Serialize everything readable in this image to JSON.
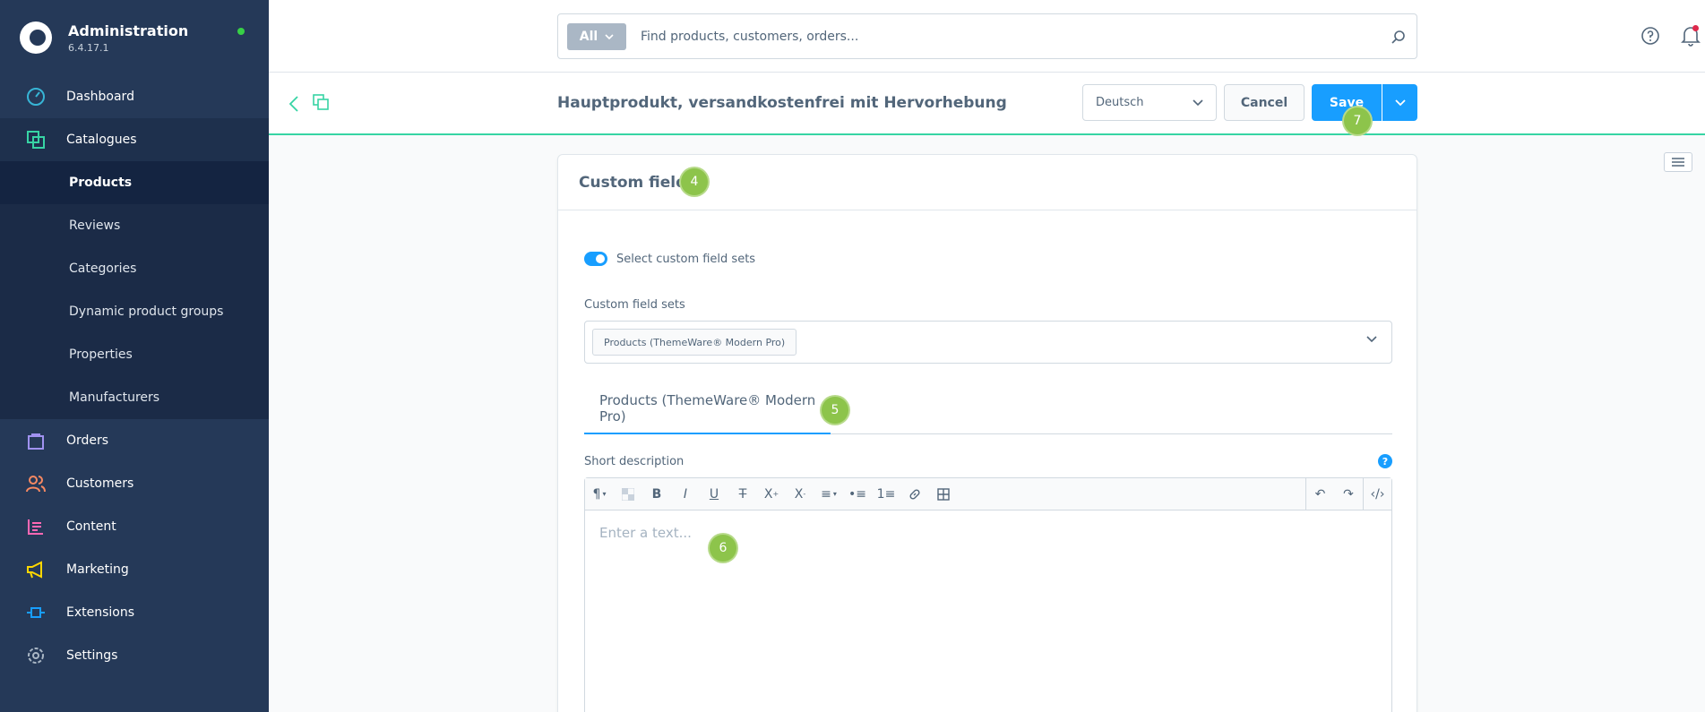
{
  "brand": {
    "title": "Administration",
    "version": "6.4.17.1"
  },
  "nav": {
    "dashboard": "Dashboard",
    "catalogues": "Catalogues",
    "sub": [
      "Products",
      "Reviews",
      "Categories",
      "Dynamic product groups",
      "Properties",
      "Manufacturers"
    ],
    "orders": "Orders",
    "customers": "Customers",
    "content": "Content",
    "marketing": "Marketing",
    "extensions": "Extensions",
    "settings": "Settings"
  },
  "search": {
    "type": "All",
    "placeholder": "Find products, customers, orders..."
  },
  "smartbar": {
    "title": "Hauptprodukt, versandkostenfrei mit Hervorhebung",
    "language": "Deutsch",
    "cancel": "Cancel",
    "save": "Save"
  },
  "card": {
    "title": "Custom fields",
    "toggle_label": "Select custom field sets",
    "sets_label": "Custom field sets",
    "chip": "Products (ThemeWare® Modern Pro)",
    "tab": "Products (ThemeWare® Modern Pro)",
    "short_description_label": "Short description",
    "help": "?",
    "editor_placeholder": "Enter a text..."
  },
  "badges": {
    "b4": "4",
    "b5": "5",
    "b6": "6",
    "b7": "7"
  },
  "colors": {
    "sidebar": "#253958",
    "accent": "#189eff",
    "badge": "#8dc44b",
    "smartbar_border": "#37d4a4"
  }
}
